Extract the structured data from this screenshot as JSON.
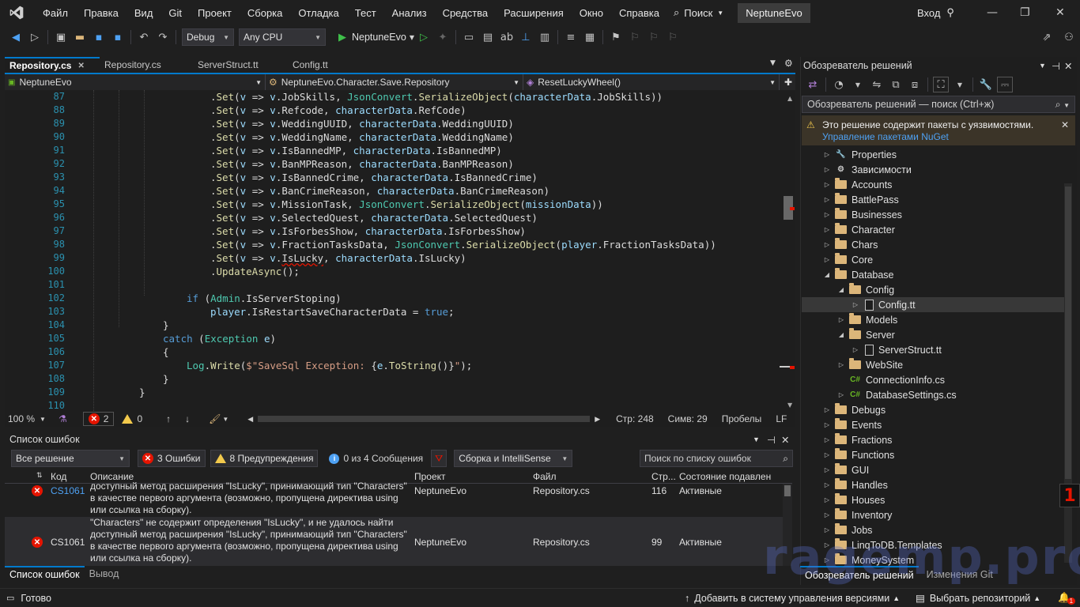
{
  "menu": [
    "Файл",
    "Правка",
    "Вид",
    "Git",
    "Проект",
    "Сборка",
    "Отладка",
    "Тест",
    "Анализ",
    "Средства",
    "Расширения",
    "Окно",
    "Справка"
  ],
  "search_label": "Поиск",
  "solution_name": "NeptuneEvo",
  "signin_label": "Вход",
  "toolbar": {
    "config": "Debug",
    "platform": "Any CPU",
    "start_target": "NeptuneEvo"
  },
  "tabs": [
    {
      "label": "Repository.cs",
      "active": true
    },
    {
      "label": "Repository.cs",
      "active": false
    },
    {
      "label": "ServerStruct.tt",
      "active": false
    },
    {
      "label": "Config.tt",
      "active": false
    }
  ],
  "navbar": {
    "project": "NeptuneEvo",
    "type": "NeptuneEvo.Character.Save.Repository",
    "member": "ResetLuckyWheel()"
  },
  "line_numbers": [
    "87",
    "88",
    "89",
    "90",
    "91",
    "92",
    "93",
    "94",
    "95",
    "96",
    "97",
    "98",
    "99",
    "100",
    "101",
    "102",
    "103",
    "104",
    "105",
    "106",
    "107",
    "108",
    "109",
    "110"
  ],
  "editor_status": {
    "zoom": "100 %",
    "errors": "2",
    "warnings": "0",
    "line": "Стр: 248",
    "col": "Симв: 29",
    "spaces": "Пробелы",
    "eol": "LF"
  },
  "error_list": {
    "title": "Список ошибок",
    "scope": "Все решение",
    "errors_btn": "3 Ошибки",
    "warnings_btn": "8 Предупреждения",
    "messages_btn": "0 из 4 Сообщения",
    "build_filter": "Сборка и IntelliSense",
    "search_placeholder": "Поиск по списку ошибок",
    "columns": [
      "Код",
      "Описание",
      "Проект",
      "Файл",
      "Стр...",
      "Состояние подавлен"
    ],
    "rows": [
      {
        "code": "CS1061",
        "desc": [
          "доступный метод расширения \"IsLucky\", принимающий тип \"Characters\"",
          "в качестве первого аргумента (возможно, пропущена директива using",
          "или ссылка на сборку)."
        ],
        "project": "NeptuneEvo",
        "file": "Repository.cs",
        "line": "116",
        "state": "Активные"
      },
      {
        "code": "CS1061",
        "desc": [
          "\"Characters\" не содержит определения \"IsLucky\", и не удалось найти",
          "доступный метод расширения \"IsLucky\", принимающий тип \"Characters\"",
          "в качестве первого аргумента (возможно, пропущена директива using",
          "или ссылка на сборку)."
        ],
        "project": "NeptuneEvo",
        "file": "Repository.cs",
        "line": "99",
        "state": "Активные"
      }
    ]
  },
  "bottom_tabs": [
    "Список ошибок",
    "Вывод"
  ],
  "statusbar": {
    "ready": "Готово",
    "vcs": "Добавить в систему управления версиями",
    "repo": "Выбрать репозиторий",
    "notifications": "1"
  },
  "solution_explorer": {
    "title": "Обозреватель решений",
    "search_placeholder": "Обозреватель решений — поиск (Ctrl+ж)",
    "warning_text": "Это решение содержит пакеты с уязвимостями.",
    "warning_link": "Управление пакетами NuGet",
    "items": [
      {
        "label": "Properties",
        "kind": "props",
        "depth": 0,
        "twisty": "▷"
      },
      {
        "label": "Зависимости",
        "kind": "deps",
        "depth": 0,
        "twisty": "▷"
      },
      {
        "label": "Accounts",
        "kind": "folder",
        "depth": 0,
        "twisty": "▷"
      },
      {
        "label": "BattlePass",
        "kind": "folder",
        "depth": 0,
        "twisty": "▷"
      },
      {
        "label": "Businesses",
        "kind": "folder",
        "depth": 0,
        "twisty": "▷"
      },
      {
        "label": "Character",
        "kind": "folder",
        "depth": 0,
        "twisty": "▷"
      },
      {
        "label": "Chars",
        "kind": "folder",
        "depth": 0,
        "twisty": "▷"
      },
      {
        "label": "Core",
        "kind": "folder",
        "depth": 0,
        "twisty": "▷"
      },
      {
        "label": "Database",
        "kind": "folder",
        "depth": 0,
        "twisty": "◢"
      },
      {
        "label": "Config",
        "kind": "folder",
        "depth": 1,
        "twisty": "◢"
      },
      {
        "label": "Config.tt",
        "kind": "file",
        "depth": 2,
        "twisty": "▷",
        "selected": true
      },
      {
        "label": "Models",
        "kind": "folder",
        "depth": 1,
        "twisty": "▷"
      },
      {
        "label": "Server",
        "kind": "folder",
        "depth": 1,
        "twisty": "◢"
      },
      {
        "label": "ServerStruct.tt",
        "kind": "file",
        "depth": 2,
        "twisty": "▷"
      },
      {
        "label": "WebSite",
        "kind": "folder",
        "depth": 1,
        "twisty": "▷"
      },
      {
        "label": "ConnectionInfo.cs",
        "kind": "cs",
        "depth": 1,
        "twisty": ""
      },
      {
        "label": "DatabaseSettings.cs",
        "kind": "cs",
        "depth": 1,
        "twisty": "▷"
      },
      {
        "label": "Debugs",
        "kind": "folder",
        "depth": 0,
        "twisty": "▷"
      },
      {
        "label": "Events",
        "kind": "folder",
        "depth": 0,
        "twisty": "▷"
      },
      {
        "label": "Fractions",
        "kind": "folder",
        "depth": 0,
        "twisty": "▷"
      },
      {
        "label": "Functions",
        "kind": "folder",
        "depth": 0,
        "twisty": "▷"
      },
      {
        "label": "GUI",
        "kind": "folder",
        "depth": 0,
        "twisty": "▷"
      },
      {
        "label": "Handles",
        "kind": "folder",
        "depth": 0,
        "twisty": "▷"
      },
      {
        "label": "Houses",
        "kind": "folder",
        "depth": 0,
        "twisty": "▷"
      },
      {
        "label": "Inventory",
        "kind": "folder",
        "depth": 0,
        "twisty": "▷"
      },
      {
        "label": "Jobs",
        "kind": "folder",
        "depth": 0,
        "twisty": "▷"
      },
      {
        "label": "LinqToDB.Templates",
        "kind": "folder",
        "depth": 0,
        "twisty": "▷"
      },
      {
        "label": "MoneySystem",
        "kind": "folder",
        "depth": 0,
        "twisty": "▷"
      }
    ],
    "tabs": [
      "Обозреватель решений",
      "Изменения Git"
    ]
  },
  "watermark": "ragemp.pro",
  "badge": "1",
  "colors": {
    "accent": "#007acc",
    "error": "#e51400",
    "keyword": "#569cd6",
    "type": "#4ec9b0",
    "method": "#dcdcaa",
    "param": "#9cdcfe",
    "string": "#d69d85",
    "folder": "#dcb67a"
  }
}
